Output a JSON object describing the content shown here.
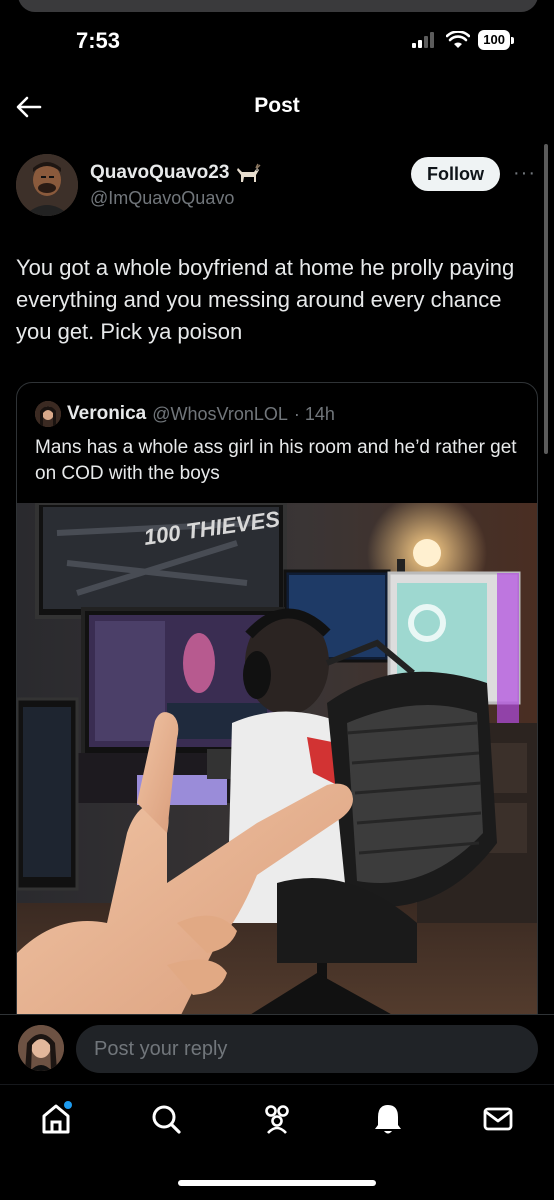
{
  "status_bar": {
    "time": "7:53",
    "battery": "100"
  },
  "header": {
    "title": "Post"
  },
  "post": {
    "author_name": "QuavoQuavo23",
    "author_handle": "@ImQuavoQuavo",
    "follow_label": "Follow",
    "more_label": "···",
    "text": "You got a whole boyfriend at home he prolly paying everything and you messing around every chance you get. Pick ya poison"
  },
  "quote": {
    "author_name": "Veronica",
    "author_handle": "@WhosVronLOL",
    "time": "· 14h",
    "text": "Mans has a whole ass girl in his room and he’d rather get on COD with the boys",
    "image_caption": "100 THIEVES"
  },
  "reply": {
    "placeholder": "Post your reply"
  },
  "nav": {
    "items": [
      "home-icon",
      "search-icon",
      "communities-icon",
      "notifications-icon",
      "messages-icon"
    ]
  },
  "colors": {
    "background": "#000000",
    "text_primary": "#e7e9ea",
    "text_secondary": "#71767b",
    "border": "#2f3336",
    "accent": "#1d9bf0"
  }
}
